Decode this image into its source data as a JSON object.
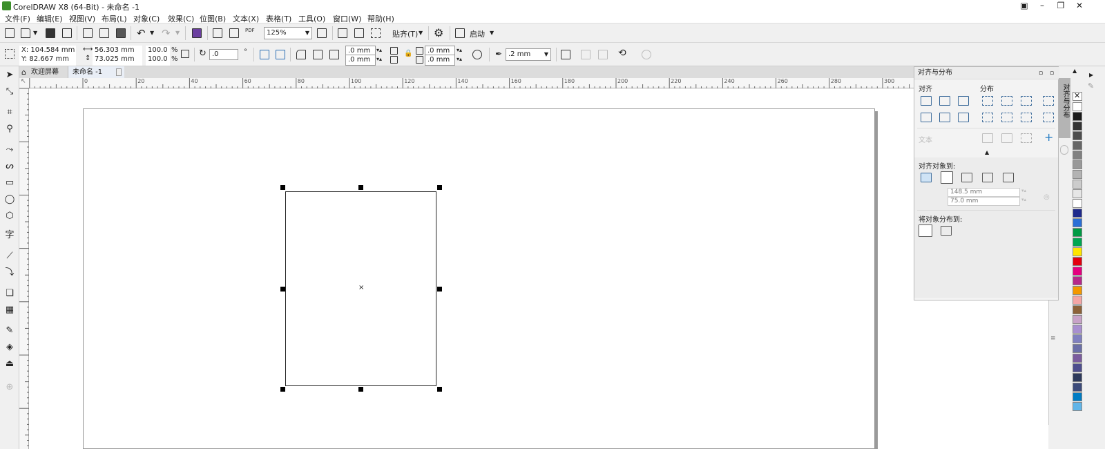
{
  "window": {
    "title": "CorelDRAW X8 (64-Bit) - 未命名 -1"
  },
  "menu": [
    "文件(F)",
    "编辑(E)",
    "视图(V)",
    "布局(L)",
    "对象(C)",
    "效果(C)",
    "位图(B)",
    "文本(X)",
    "表格(T)",
    "工具(O)",
    "窗口(W)",
    "帮助(H)"
  ],
  "toolbar1": {
    "zoom": "125%",
    "snap_label": "贴齐(T)",
    "launch_label": "启动",
    "pdf_label": "PDF"
  },
  "props": {
    "x": "X: 104.584 mm",
    "y": "Y: 82.667 mm",
    "w": "56.303 mm",
    "h": "73.025 mm",
    "sx": "100.0",
    "sy": "100.0",
    "pct": "%",
    "rotation": ".0",
    "deg": "°",
    "corner_h": ".0 mm",
    "corner_v": ".0 mm",
    "corner_h2": ".0 mm",
    "corner_v2": ".0 mm",
    "outline": ".2 mm"
  },
  "tabs": {
    "welcome": "欢迎屏幕",
    "doc": "未命名 -1"
  },
  "ruler_h": [
    "0",
    "20",
    "40",
    "60",
    "80",
    "100",
    "120",
    "140",
    "160",
    "180",
    "200",
    "220",
    "240",
    "260",
    "280",
    "300"
  ],
  "docker": {
    "title": "对齐与分布",
    "align": "对齐",
    "distribute": "分布",
    "text": "文本",
    "align_to": "对齐对象到:",
    "x_val": "148.5 mm",
    "y_val": "75.0 mm",
    "dist_to": "将对象分布到:",
    "vtab": "对齐与分布"
  },
  "palette_colors": [
    "#ffffff",
    "#1a1a1a",
    "#333333",
    "#4d4d4d",
    "#666666",
    "#808080",
    "#999999",
    "#b3b3b3",
    "#cccccc",
    "#e6e6e6",
    "#ffffff",
    "#1f2a8c",
    "#2b6fd6",
    "#009a44",
    "#00a651",
    "#ffe600",
    "#e3000f",
    "#e4007f",
    "#b6288a",
    "#f39800",
    "#f4a6a6",
    "#8c6239",
    "#c8a2c8",
    "#a88fd0",
    "#8080c0",
    "#6b6fa8",
    "#7b5c9e",
    "#4e4e8e",
    "#2e3a5c",
    "#3c4b7a",
    "#007cc3",
    "#61b5e8"
  ],
  "colors": {
    "accent": "#3d8f2c",
    "selection": "#000000"
  }
}
